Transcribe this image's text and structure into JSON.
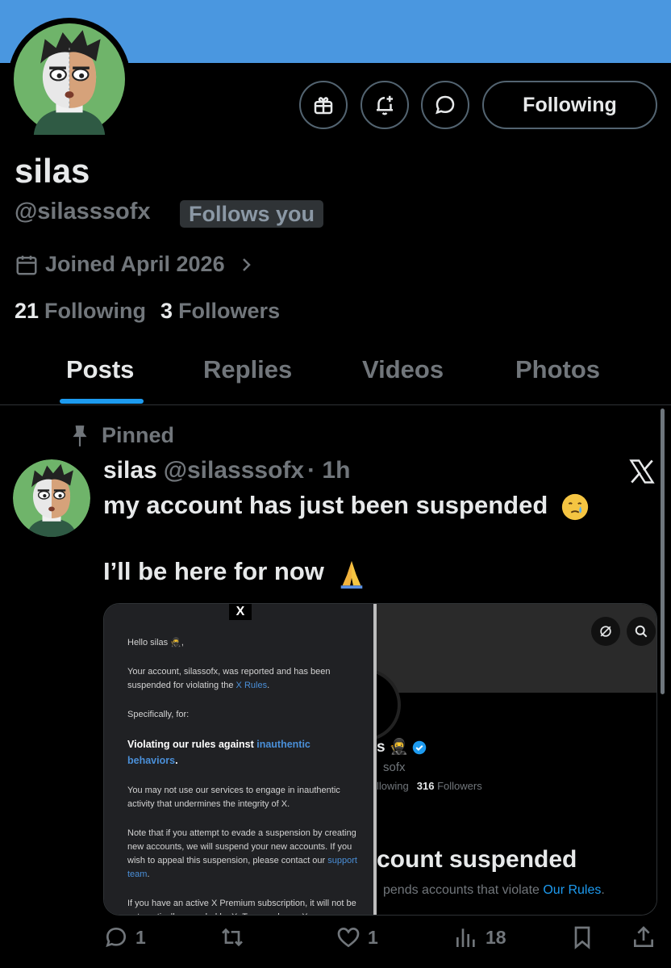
{
  "profile": {
    "name": "silas",
    "handle": "@silasssofx",
    "follows_you": "Follows you",
    "joined": "Joined April 2026",
    "following_count": "21",
    "following_label": "Following",
    "followers_count": "3",
    "followers_label": "Followers",
    "follow_button": "Following",
    "banner_color": "#4a97e0"
  },
  "header_icons": [
    "gift-icon",
    "notification-bell-icon",
    "message-icon"
  ],
  "tabs": [
    {
      "label": "Posts",
      "active": true
    },
    {
      "label": "Replies",
      "active": false
    },
    {
      "label": "Videos",
      "active": false
    },
    {
      "label": "Photos",
      "active": false
    }
  ],
  "post": {
    "pinned_label": "Pinned",
    "author": "silas",
    "handle": "@silasssofx",
    "time": "· 1h",
    "line1": "my account has just been suspended",
    "line2": "I’ll be here for now",
    "emoji1": "crying-face-emoji",
    "emoji2": "folded-hands-emoji",
    "media": {
      "email": {
        "x_badge": "X",
        "greeting": "Hello silas 🥷,",
        "p1_a": "Your account, silassofx, was reported and has been suspended for violating the ",
        "p1_link": "X Rules",
        "p1_b": ".",
        "p2": "Specifically, for:",
        "p3_a": "Violating our rules against ",
        "p3_link": "inauthentic behaviors",
        "p3_b": ".",
        "p4": "You may not use our services to engage in inauthentic activity that undermines the integrity of X.",
        "p5_a": "Note that if you attempt to evade a suspension by creating new accounts, we will suspend your new accounts. If you wish to appeal this suspension, please contact our ",
        "p5_link": "support team",
        "p5_b": ".",
        "p6": "If you have an active X Premium subscription, it will not be automatically canceled by X. To cancel your X"
      },
      "profile_shot": {
        "name_fragment": "s 🥷",
        "handle_fragment": "sofx",
        "following_fragment": "llowing",
        "followers_count": "316",
        "followers_label": "Followers",
        "suspended_title": "count suspended",
        "suspended_sub_a": "pends accounts that violate ",
        "suspended_sub_link": "Our Rules",
        "suspended_sub_b": "."
      }
    },
    "actions": {
      "replies": "1",
      "reposts": "",
      "likes": "1",
      "views": "18"
    }
  }
}
